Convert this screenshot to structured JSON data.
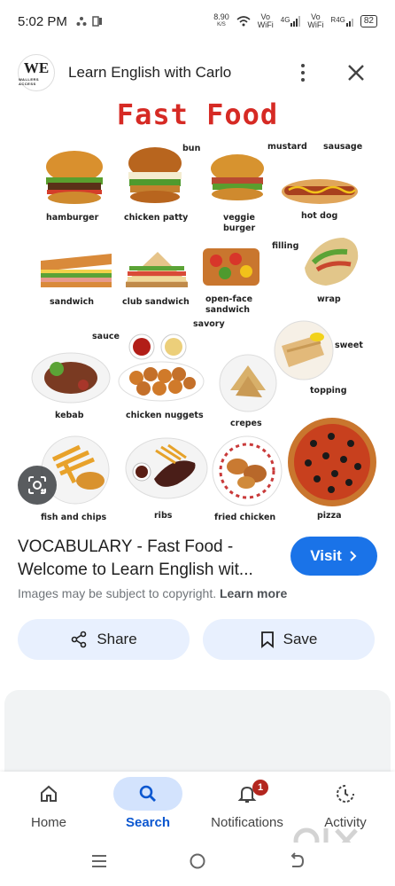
{
  "status_bar": {
    "time": "5:02 PM",
    "speed_value": "8.90",
    "speed_unit": "K/S",
    "wifi1_top": "Vo",
    "wifi1_bottom": "WiFi",
    "net1": "4G",
    "wifi2_top": "Vo",
    "wifi2_bottom": "WiFi",
    "net2": "R4G",
    "battery": "82"
  },
  "header": {
    "logo_text": "WE",
    "logo_subtext": "WALLERS ACCESS",
    "title": "Learn English with Carlo"
  },
  "image": {
    "title": "Fast Food",
    "labels": {
      "bun": "bun",
      "mustard": "mustard",
      "sausage": "sausage",
      "hamburger": "hamburger",
      "chicken_patty": "chicken patty",
      "veggie_burger_1": "veggie",
      "veggie_burger_2": "burger",
      "hot_dog": "hot dog",
      "filling": "filling",
      "sandwich": "sandwich",
      "club_sandwich": "club sandwich",
      "open_face_1": "open-face",
      "open_face_2": "sandwich",
      "wrap": "wrap",
      "savory": "savory",
      "sauce": "sauce",
      "sweet": "sweet",
      "topping": "topping",
      "kebab": "kebab",
      "chicken_nuggets": "chicken nuggets",
      "crepes": "crepes",
      "fish_and_chips": "fish and chips",
      "ribs": "ribs",
      "fried_chicken": "fried chicken",
      "pizza": "pizza"
    }
  },
  "result": {
    "title_line1": "VOCABULARY - Fast Food -",
    "title_line2": "Welcome to Learn English wit...",
    "visit_label": "Visit",
    "copyright_text": "Images may be subject to copyright.",
    "learn_more": "Learn more"
  },
  "actions": {
    "share_label": "Share",
    "save_label": "Save"
  },
  "bottom_nav": {
    "items": [
      {
        "label": "Home"
      },
      {
        "label": "Search"
      },
      {
        "label": "Notifications",
        "badge": "1"
      },
      {
        "label": "Activity"
      }
    ]
  },
  "watermark": "olx",
  "colors": {
    "accent": "#1a73e8",
    "nav_active": "#0b57d0",
    "chip_bg": "#e8f0fe",
    "title_red": "#d62a24",
    "badge": "#b3261e"
  },
  "icons": [
    "search-icon",
    "share-icon",
    "bookmark-icon",
    "home-icon",
    "bell-icon",
    "activity-icon",
    "lens-icon",
    "close-icon",
    "more-vert-icon"
  ]
}
